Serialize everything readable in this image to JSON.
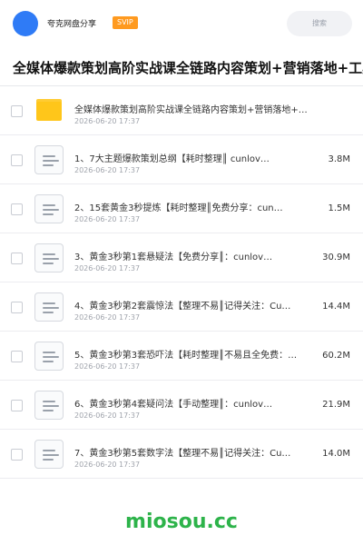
{
  "header": {
    "username": "夸克网盘分享",
    "vip_badge": "SVIP",
    "search_placeholder": "搜索"
  },
  "folder_title": "全媒体爆款策划高阶实战课全链路内容策划+营销落地+工具",
  "files": [
    {
      "type": "folder",
      "name": "全媒体爆款策划高阶实战课全链路内容策划+营销落地+…",
      "date": "2026-06-20 17:37",
      "size": ""
    },
    {
      "type": "doc",
      "name": "1、7大主题爆款策划总纲【耗时整理║ cunlov…",
      "date": "2026-06-20 17:37",
      "size": "3.8M"
    },
    {
      "type": "doc",
      "name": "2、15套黄金3秒提炼【耗时整理║免费分享：cun…",
      "date": "2026-06-20 17:37",
      "size": "1.5M"
    },
    {
      "type": "doc",
      "name": "3、黄金3秒第1套悬疑法【免费分享║：cunlov…",
      "date": "2026-06-20 17:37",
      "size": "30.9M"
    },
    {
      "type": "doc",
      "name": "4、黄金3秒第2套震惊法【整理不易║记得关注：Cu…",
      "date": "2026-06-20 17:37",
      "size": "14.4M"
    },
    {
      "type": "doc",
      "name": "5、黄金3秒第3套恐吓法【耗时整理║不易且全免费：…",
      "date": "2026-06-20 17:37",
      "size": "60.2M"
    },
    {
      "type": "doc",
      "name": "6、黄金3秒第4套疑问法【手动整理║：cunlov…",
      "date": "2026-06-20 17:37",
      "size": "21.9M"
    },
    {
      "type": "doc",
      "name": "7、黄金3秒第5套数字法【整理不易║记得关注：Cu…",
      "date": "2026-06-20 17:37",
      "size": "14.0M"
    }
  ],
  "watermark": "miosou.cc",
  "colors": {
    "accent": "#2f7bf6",
    "vip": "#ff9a1f",
    "watermark": "#2db34a",
    "folder": "#ffc61a"
  }
}
